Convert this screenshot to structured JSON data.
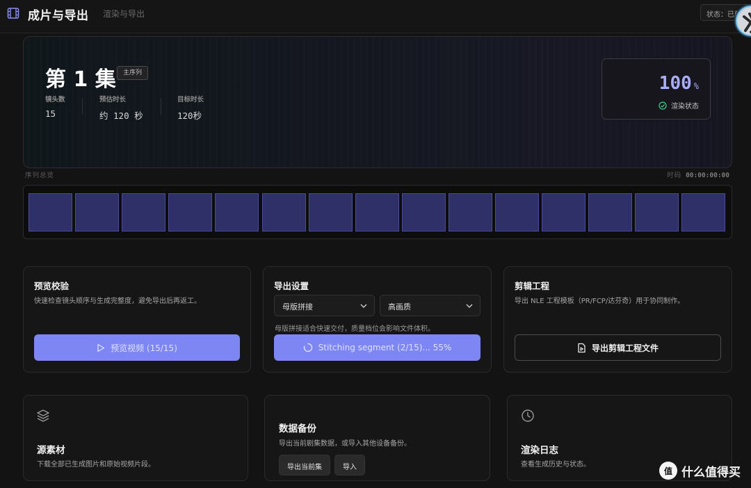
{
  "header": {
    "title": "成片与导出",
    "subtitle": "渲染与导出",
    "status_text": "状态：已就绪",
    "app_icon": "film-icon"
  },
  "hero": {
    "episode_title": "第 1 集",
    "sequence_tag": "主序列",
    "stats": [
      {
        "label": "镜头数",
        "value": "15"
      },
      {
        "label": "预估时长",
        "value": "约 120 秒"
      },
      {
        "label": "目标时长",
        "value": "120秒"
      }
    ],
    "render_percent": "100",
    "render_unit": "%",
    "render_status": "渲染状态"
  },
  "sequence": {
    "caption": "序列总览",
    "timecode_label": "时码",
    "timecode": "00:00:00:00",
    "shot_count": 15
  },
  "cards": {
    "preview": {
      "title": "预览校验",
      "desc": "快速检查镜头顺序与生成完整度，避免导出后再返工。",
      "button": "预览视频 (15/15)"
    },
    "export": {
      "title": "导出设置",
      "mode_select": "母版拼接",
      "quality_select": "高画质",
      "hint": "母版拼接适合快速交付，质量档位会影响文件体积。",
      "progress_button": "Stitching segment (2/15)... 55%"
    },
    "nle": {
      "title": "剪辑工程",
      "desc": "导出 NLE 工程模板（PR/FCP/达芬奇）用于协同制作。",
      "button": "导出剪辑工程文件"
    },
    "assets": {
      "title": "源素材",
      "desc": "下载全部已生成图片和原始视频片段。"
    },
    "backup": {
      "title": "数据备份",
      "desc": "导出当前剧集数据，或导入其他设备备份。",
      "export_button": "导出当前集",
      "import_button": "导入"
    },
    "log": {
      "title": "渲染日志",
      "desc": "查看生成历史与状态。"
    }
  },
  "watermark": {
    "badge": "值",
    "text": "什么值得买"
  },
  "colors": {
    "accent": "#7e86f4",
    "shot_fill": "#2f3068",
    "success": "#3ec98a"
  }
}
